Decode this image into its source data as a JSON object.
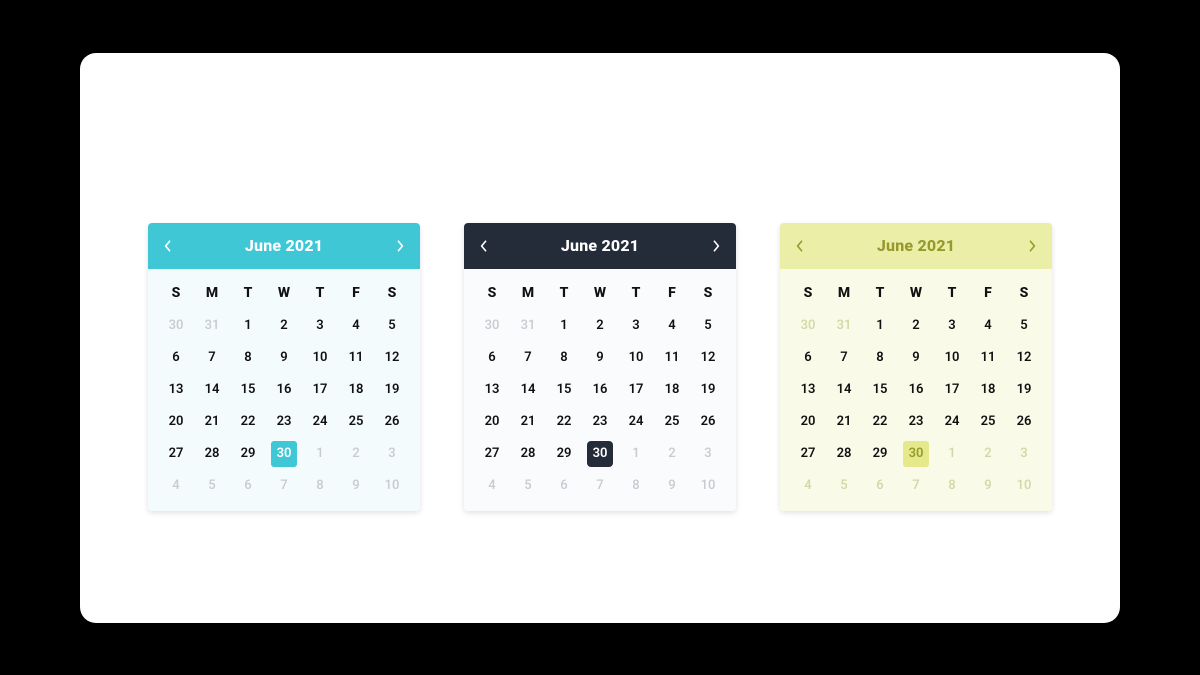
{
  "weekday_labels": [
    "S",
    "M",
    "T",
    "W",
    "T",
    "F",
    "S"
  ],
  "grid": [
    {
      "d": "30",
      "mute": true
    },
    {
      "d": "31",
      "mute": true
    },
    {
      "d": "1"
    },
    {
      "d": "2"
    },
    {
      "d": "3"
    },
    {
      "d": "4"
    },
    {
      "d": "5"
    },
    {
      "d": "6"
    },
    {
      "d": "7"
    },
    {
      "d": "8"
    },
    {
      "d": "9"
    },
    {
      "d": "10"
    },
    {
      "d": "11"
    },
    {
      "d": "12"
    },
    {
      "d": "13"
    },
    {
      "d": "14"
    },
    {
      "d": "15"
    },
    {
      "d": "16"
    },
    {
      "d": "17"
    },
    {
      "d": "18"
    },
    {
      "d": "19"
    },
    {
      "d": "20"
    },
    {
      "d": "21"
    },
    {
      "d": "22"
    },
    {
      "d": "23"
    },
    {
      "d": "24"
    },
    {
      "d": "25"
    },
    {
      "d": "26"
    },
    {
      "d": "27"
    },
    {
      "d": "28"
    },
    {
      "d": "29"
    },
    {
      "d": "30",
      "sel": true
    },
    {
      "d": "1",
      "mute": true
    },
    {
      "d": "2",
      "mute": true
    },
    {
      "d": "3",
      "mute": true
    },
    {
      "d": "4",
      "mute": true
    },
    {
      "d": "5",
      "mute": true
    },
    {
      "d": "6",
      "mute": true
    },
    {
      "d": "7",
      "mute": true
    },
    {
      "d": "8",
      "mute": true
    },
    {
      "d": "9",
      "mute": true
    },
    {
      "d": "10",
      "mute": true
    }
  ],
  "calendars": [
    {
      "title": "June 2021",
      "variant": "v1"
    },
    {
      "title": "June 2021",
      "variant": "v2"
    },
    {
      "title": "June 2021",
      "variant": "v3"
    }
  ],
  "colors": {
    "teal": "#3fc7d6",
    "navy": "#242c3a",
    "olive_bg": "#ebeea6",
    "olive_text": "#969a2c"
  }
}
